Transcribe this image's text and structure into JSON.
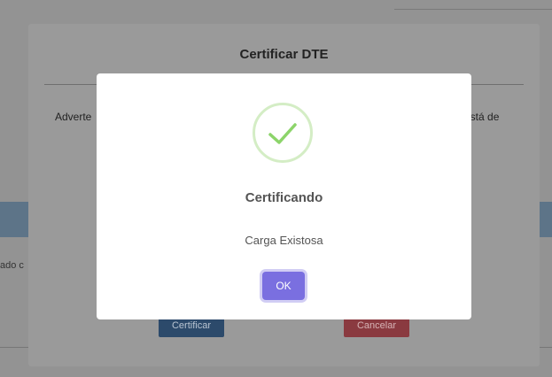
{
  "background_page": {
    "left_fragment": "ado c"
  },
  "outer_modal": {
    "title": "Certificar DTE",
    "warning_text_left": "Adverte",
    "warning_text_right": "está de",
    "certify_button": "Certificar",
    "cancel_button": "Cancelar"
  },
  "alert": {
    "icon": "checkmark-icon",
    "title": "Certificando",
    "message": "Carga Existosa",
    "ok_button": "OK",
    "colors": {
      "ok_button": "#7a6fe0",
      "success_ring": "#d4edc5",
      "success_check": "#8cd46a"
    }
  }
}
